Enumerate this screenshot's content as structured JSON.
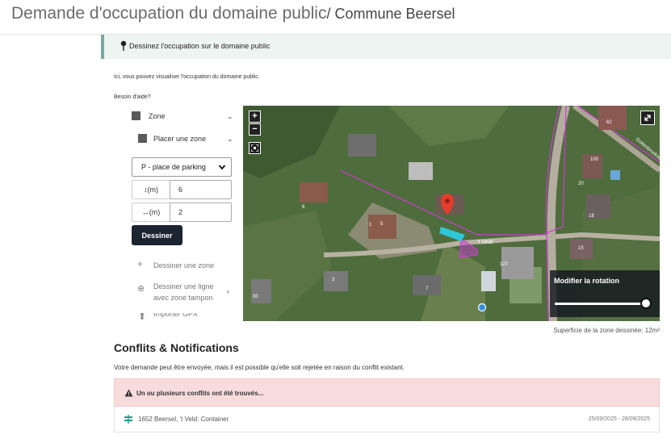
{
  "header": {
    "title": "Demande d'occupation du domaine public",
    "separator": "/ ",
    "commune": "Commune Beersel"
  },
  "info_banner": {
    "text": "Dessinez l'occupation sur le domaine public"
  },
  "intro": "Ici, vous pouvez visualiser l'occupation du domaine public.",
  "help_text": "Besoin d'aide?",
  "panel": {
    "zone_label": "Zone",
    "placer_label": "Placer une zone",
    "type_select": {
      "value": "P - place de parking",
      "options": [
        "P - place de parking"
      ]
    },
    "height": {
      "label": "↕(m)",
      "value": "6"
    },
    "width": {
      "label": "↔(m)",
      "value": "2"
    },
    "draw_button": "Dessiner",
    "tools": [
      {
        "label": "Dessiner une zone",
        "icon": "plus-icon"
      },
      {
        "label": "Dessiner une ligne avec zone tampon",
        "icon": "plus-circle-icon"
      },
      {
        "label": "Importer GPX",
        "icon": "upload-icon"
      }
    ]
  },
  "map": {
    "zoom_in": "+",
    "zoom_out": "−",
    "rotation_label": "Modifier la rotation",
    "rotation_value": 1.0,
    "street_label": "'t Veld",
    "road_label": "Gottenbroekstraat",
    "house_numbers": [
      "1",
      "5",
      "6",
      "3",
      "7",
      "127",
      "18",
      "15",
      "30",
      "20",
      "62",
      "100"
    ]
  },
  "surface_text": "Superficie de la zone dessinée: 12m²",
  "conflicts": {
    "heading": "Conflits & Notifications",
    "notice": "Votre demande peut être envoyée, mais il est possible qu'elle soit rejetée en raison du conflit existant.",
    "alert": "Un ou plusieurs conflits ont été trouvés...",
    "items": [
      {
        "text": "1652 Beersel, 't Veld: Container",
        "dates": "25/09/2025 - 28/09/2025"
      }
    ]
  }
}
